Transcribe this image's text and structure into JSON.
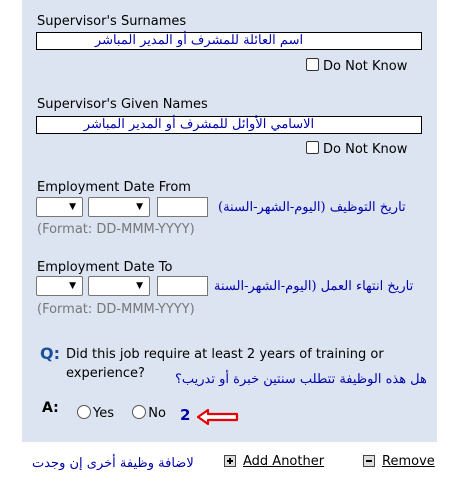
{
  "surnames": {
    "label": "Supervisor's Surnames",
    "arabic": "اسم العائلة للمشرف أو المدير المباشر",
    "dnk": "Do Not Know"
  },
  "given": {
    "label": "Supervisor's Given Names",
    "arabic": "الاسامي الأوائل للمشرف أو المدير المباشر",
    "dnk": "Do Not Know"
  },
  "from": {
    "label": "Employment Date From",
    "arabic": "تاريخ التوظيف (اليوم-الشهر-السنة)",
    "format": "(Format: DD-MMM-YYYY)"
  },
  "to": {
    "label": "Employment Date To",
    "arabic": "تاريخ انتهاء العمل (اليوم-الشهر-السنة",
    "format": "(Format: DD-MMM-YYYY)"
  },
  "question": {
    "q": "Q:",
    "text": "Did this job require at least 2 years of training or experience?",
    "arabic": "هل هذه الوظيفة تتطلب سنتين خبرة أو تدريب؟",
    "a": "A:",
    "yes": "Yes",
    "no": "No",
    "annotation": "2"
  },
  "footer": {
    "arabic": "لاضافة وظيفة أخرى إن وجدت",
    "add": "Add Another",
    "remove": "Remove"
  },
  "colors": {
    "panel": "#dde4f1",
    "arabic_text": "#0000aa",
    "arrow": "#e60000"
  }
}
